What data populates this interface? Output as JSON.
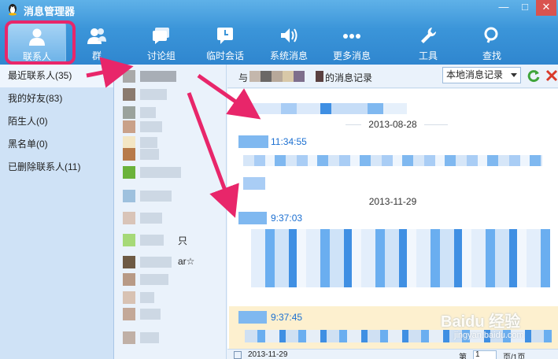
{
  "window": {
    "title": "消息管理器",
    "minimize": "—",
    "maximize": "□",
    "close": "✕"
  },
  "toolbar": [
    {
      "label": "联系人",
      "icon": "contact-icon"
    },
    {
      "label": "群",
      "icon": "group-icon"
    },
    {
      "label": "讨论组",
      "icon": "discussion-icon"
    },
    {
      "label": "临时会话",
      "icon": "temp-session-icon"
    },
    {
      "label": "系统消息",
      "icon": "speaker-icon"
    },
    {
      "label": "更多消息",
      "icon": "more-icon"
    },
    {
      "label": "工具",
      "icon": "wrench-icon"
    },
    {
      "label": "查找",
      "icon": "search-icon"
    }
  ],
  "categories": [
    {
      "label": "最近联系人(35)"
    },
    {
      "label": "我的好友(83)"
    },
    {
      "label": "陌生人(0)"
    },
    {
      "label": "黑名单(0)"
    },
    {
      "label": "已删除联系人(11)"
    }
  ],
  "contacts": {
    "partial_1": "只",
    "partial_2": "ar☆"
  },
  "header": {
    "prefix": "与",
    "suffix": "的消息记录",
    "source": "本地消息记录"
  },
  "messages": {
    "date1": "2013-08-28",
    "time1": "11:34:55",
    "date2": "2013-11-29",
    "time2": "9:37:03",
    "time3": "9:37:45"
  },
  "footer": {
    "date": "2013-11-29",
    "page_prefix": "第",
    "page_value": "1",
    "page_suffix": "页/1页"
  },
  "watermark": {
    "brand": "Baidu 经验",
    "url": "jingyan.baidu.com"
  },
  "colors": {
    "accent": "#2f86cf",
    "highlight": "#e8266a",
    "time": "#1b6fd1"
  }
}
